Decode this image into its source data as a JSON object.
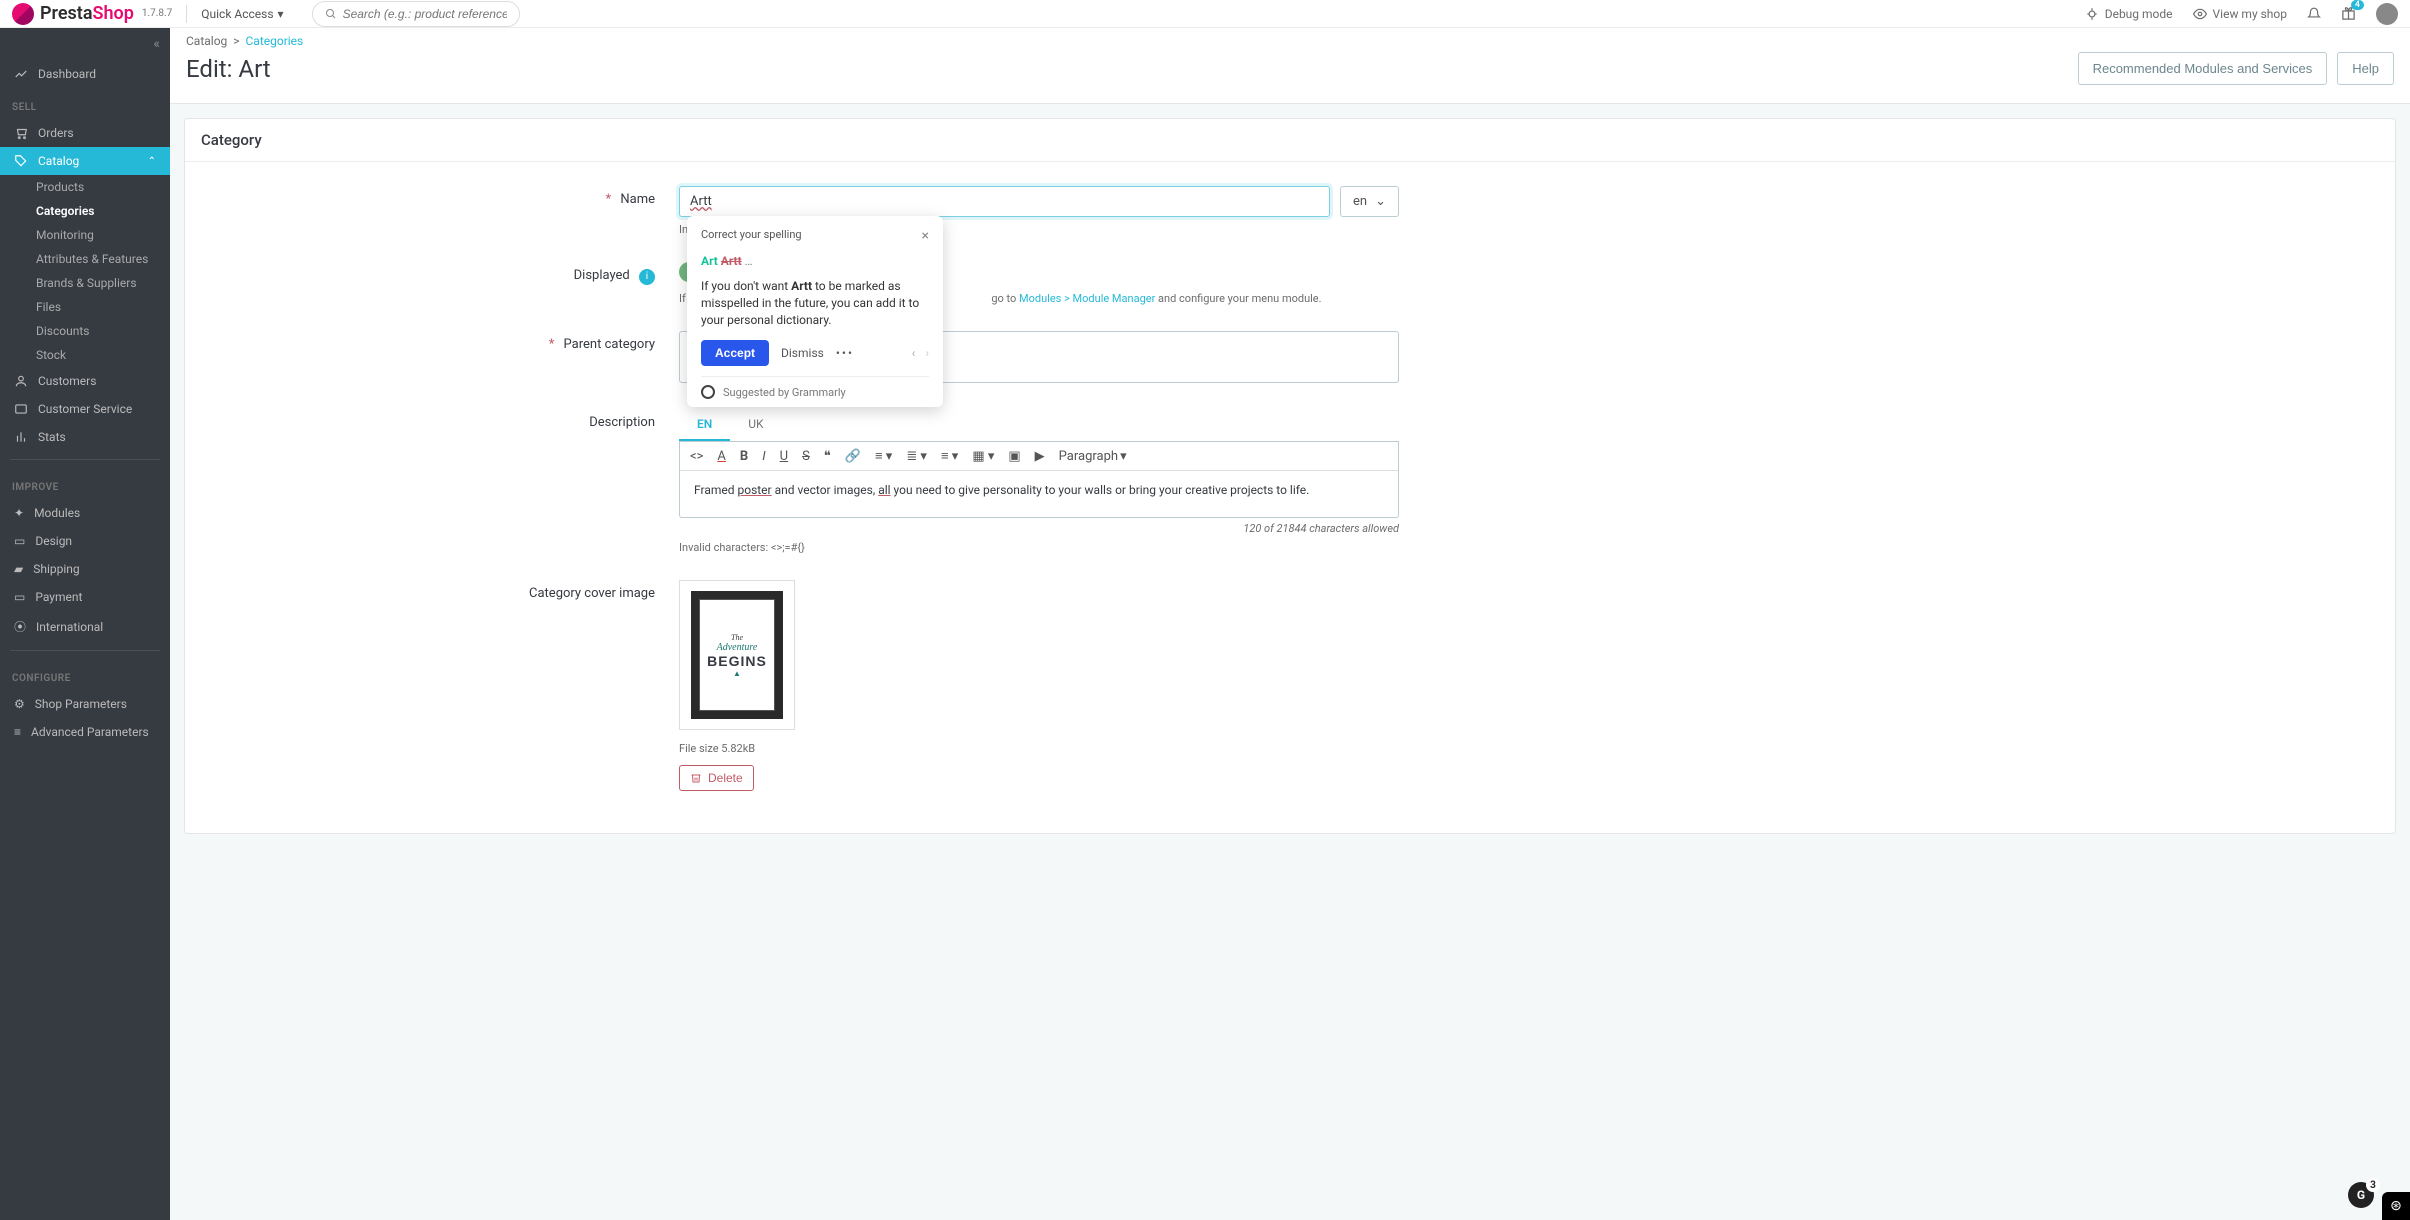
{
  "topbar": {
    "brand1": "Presta",
    "brand2": "Shop",
    "version": "1.7.8.7",
    "quick_access": "Quick Access",
    "search_placeholder": "Search (e.g.: product reference, custon",
    "debug": "Debug mode",
    "view_shop": "View my shop",
    "notif_count": "4"
  },
  "breadcrumb": {
    "root": "Catalog",
    "leaf": "Categories"
  },
  "page": {
    "title": "Edit: Art",
    "btn_recommended": "Recommended Modules and Services",
    "btn_help": "Help"
  },
  "sidebar": {
    "dashboard": "Dashboard",
    "sell": "SELL",
    "improve": "IMPROVE",
    "configure": "CONFIGURE",
    "items": {
      "orders": "Orders",
      "catalog": "Catalog",
      "customers": "Customers",
      "customer_service": "Customer Service",
      "stats": "Stats",
      "modules": "Modules",
      "design": "Design",
      "shipping": "Shipping",
      "payment": "Payment",
      "international": "International",
      "shop_params": "Shop Parameters",
      "adv_params": "Advanced Parameters"
    },
    "catalog_sub": {
      "products": "Products",
      "categories": "Categories",
      "monitoring": "Monitoring",
      "attributes": "Attributes & Features",
      "brands": "Brands & Suppliers",
      "files": "Files",
      "discounts": "Discounts",
      "stock": "Stock"
    }
  },
  "panel": {
    "title": "Category"
  },
  "form": {
    "name_label": "Name",
    "name_value": "Artt",
    "name_lang": "en",
    "name_hint_prefix": "In",
    "displayed_label": "Displayed",
    "displayed_hint_prefix": "If",
    "displayed_hint_mid": "go to",
    "displayed_hint_link": "Modules > Module Manager",
    "displayed_hint_end": " and configure your menu module.",
    "parent_label": "Parent category",
    "description_label": "Description",
    "tabs": {
      "en": "En",
      "uk": "uk"
    },
    "rte_text_1": "Framed ",
    "rte_text_poster": "poster",
    "rte_text_2": " and vector images, ",
    "rte_text_all": "all",
    "rte_text_3": " you need to give personality to your walls or bring your creative projects to life.",
    "rte_paragraph": "Paragraph",
    "counter": "120 of 21844 characters allowed",
    "invalid_chars": "Invalid characters: <>;=#{}",
    "cover_label": "Category cover image",
    "file_size": "File size 5.82kB",
    "delete": "Delete",
    "poster_txt1": "The",
    "poster_txt2": "Adventure",
    "poster_txt3": "BEGINS"
  },
  "grammarly": {
    "title": "Correct your spelling",
    "correct": "Art",
    "wrong": "Artt",
    "dots": "…",
    "desc1": "If you don't want ",
    "desc_bold": "Artt",
    "desc2": " to be marked as misspelled in the future, you can add it to your personal dictionary.",
    "accept": "Accept",
    "dismiss": "Dismiss",
    "more": "•••",
    "foot": "Suggested by Grammarly",
    "float_count": "3"
  }
}
